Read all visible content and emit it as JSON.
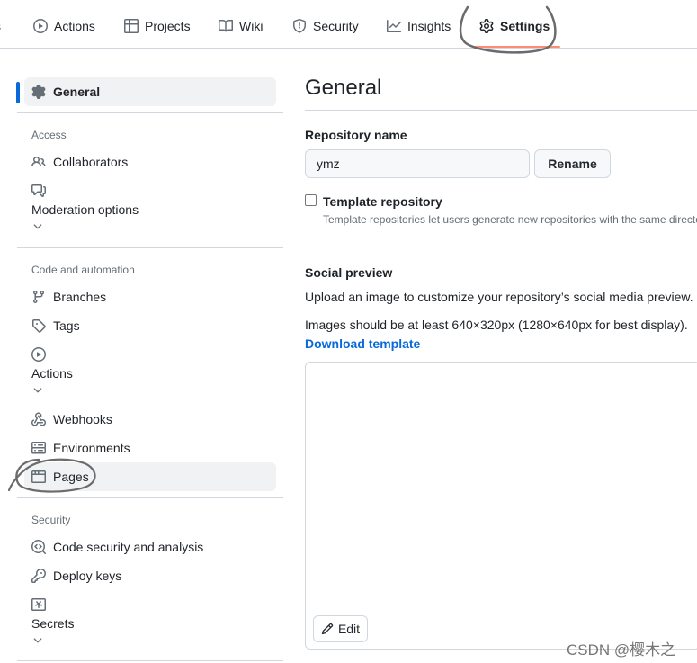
{
  "topnav": {
    "clipped_label": "s",
    "tabs": {
      "actions": "Actions",
      "projects": "Projects",
      "wiki": "Wiki",
      "security": "Security",
      "insights": "Insights",
      "settings": "Settings"
    },
    "active_tab": "Settings",
    "accent_color": "#fd8c73"
  },
  "sidebar": {
    "general": "General",
    "sections": {
      "access": "Access",
      "code_automation": "Code and automation",
      "security": "Security"
    },
    "items": {
      "collaborators": "Collaborators",
      "moderation": "Moderation options",
      "branches": "Branches",
      "tags": "Tags",
      "actions": "Actions",
      "webhooks": "Webhooks",
      "environments": "Environments",
      "pages": "Pages",
      "code_security": "Code security and analysis",
      "deploy_keys": "Deploy keys",
      "secrets": "Secrets"
    },
    "selected_accent": "#0969da"
  },
  "main": {
    "title": "General",
    "repo_name_label": "Repository name",
    "repo_name_value": "ymz",
    "rename_button": "Rename",
    "template_label": "Template repository",
    "template_checked": false,
    "template_note": "Template repositories let users generate new repositories with the same directo",
    "social_preview_label": "Social preview",
    "social_preview_desc": "Upload an image to customize your repository’s social media preview.",
    "image_hint": "Images should be at least 640×320px (1280×640px for best display).",
    "download_template": "Download template",
    "edit_button": "Edit",
    "link_color": "#0969da"
  },
  "watermark": "CSDN @樱木之"
}
